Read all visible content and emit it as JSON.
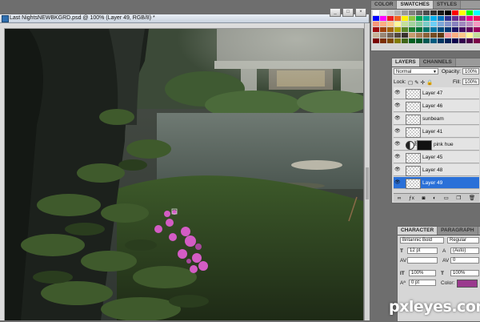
{
  "document": {
    "title": "Last NightsNEWBKGRD.psd @ 100% (Layer 49, RGB/8) *"
  },
  "window_controls": [
    "_",
    "□",
    "×"
  ],
  "swatches_panel": {
    "tabs": [
      "COLOR",
      "SWATCHES",
      "STYLES"
    ],
    "active_tab": "SWATCHES",
    "colors": [
      "#ffffff",
      "#e6e6e6",
      "#cccccc",
      "#b3b3b3",
      "#999999",
      "#808080",
      "#666666",
      "#4d4d4d",
      "#333333",
      "#1a1a1a",
      "#000000",
      "#ff0000",
      "#ffff00",
      "#00ff00",
      "#00ffff",
      "#0000ff",
      "#ff00ff",
      "#ed1c24",
      "#f26522",
      "#fff200",
      "#8dc63f",
      "#00a651",
      "#00a99d",
      "#00aeef",
      "#0072bc",
      "#2e3192",
      "#662d91",
      "#92278f",
      "#ec008c",
      "#ed145b",
      "#f7977a",
      "#fbad82",
      "#fdc68a",
      "#fff79a",
      "#c4df9b",
      "#a3d39c",
      "#82ca9d",
      "#7bcdc8",
      "#6ecff6",
      "#7ea7d8",
      "#8493ca",
      "#8882be",
      "#a187be",
      "#bc8dbf",
      "#f49ac2",
      "#9e0b0f",
      "#a0410d",
      "#a36209",
      "#aba000",
      "#598527",
      "#1a7b30",
      "#007236",
      "#00746b",
      "#0076a3",
      "#004b80",
      "#003471",
      "#1b1464",
      "#440e62",
      "#630460",
      "#9e005d",
      "#c7b299",
      "#998675",
      "#736357",
      "#534741",
      "#37302d",
      "#c69c6d",
      "#a67c52",
      "#8c6239",
      "#754c24",
      "#603913",
      "#f5989d",
      "#f9ad81",
      "#fdc689",
      "#fff799",
      "#c4df9b",
      "#790000",
      "#7b2e00",
      "#7d4900",
      "#827b00",
      "#406618",
      "#005e20",
      "#005826",
      "#005952",
      "#005b7f",
      "#003663",
      "#002157",
      "#0d004c",
      "#32004b",
      "#4b0049",
      "#7b0046"
    ]
  },
  "layers_panel": {
    "tabs": [
      "LAYERS",
      "CHANNELS"
    ],
    "active_tab": "LAYERS",
    "blend_mode": "Normal",
    "opacity_label": "Opacity:",
    "opacity_value": "100%",
    "lock_label": "Lock:",
    "fill_label": "Fill:",
    "fill_value": "100%",
    "layers": [
      {
        "name": "Layer 47",
        "selected": false,
        "type": "pixel"
      },
      {
        "name": "Layer 46",
        "selected": false,
        "type": "pixel"
      },
      {
        "name": "sunbeam",
        "selected": false,
        "type": "pixel"
      },
      {
        "name": "Layer 41",
        "selected": false,
        "type": "pixel"
      },
      {
        "name": "pink hue",
        "selected": false,
        "type": "adjustment"
      },
      {
        "name": "Layer 45",
        "selected": false,
        "type": "pixel"
      },
      {
        "name": "Layer 48",
        "selected": false,
        "type": "pixel"
      },
      {
        "name": "Layer 49",
        "selected": true,
        "type": "pixel"
      }
    ],
    "footer_icons": [
      "link-icon",
      "fx-icon",
      "mask-icon",
      "adjustment-icon",
      "group-icon",
      "new-layer-icon",
      "trash-icon"
    ]
  },
  "character_panel": {
    "tabs": [
      "CHARACTER",
      "PARAGRAPH"
    ],
    "active_tab": "CHARACTER",
    "font_family": "Britannic Bold",
    "font_style": "Regular",
    "font_size": "12 pt",
    "leading": "(Auto)",
    "tracking": "0",
    "vertical_scale": "100%",
    "horizontal_scale": "100%",
    "baseline_shift": "0 pt",
    "color_label": "Color:",
    "color_value": "#9a3a8e"
  },
  "watermark": "pxleyes.com"
}
